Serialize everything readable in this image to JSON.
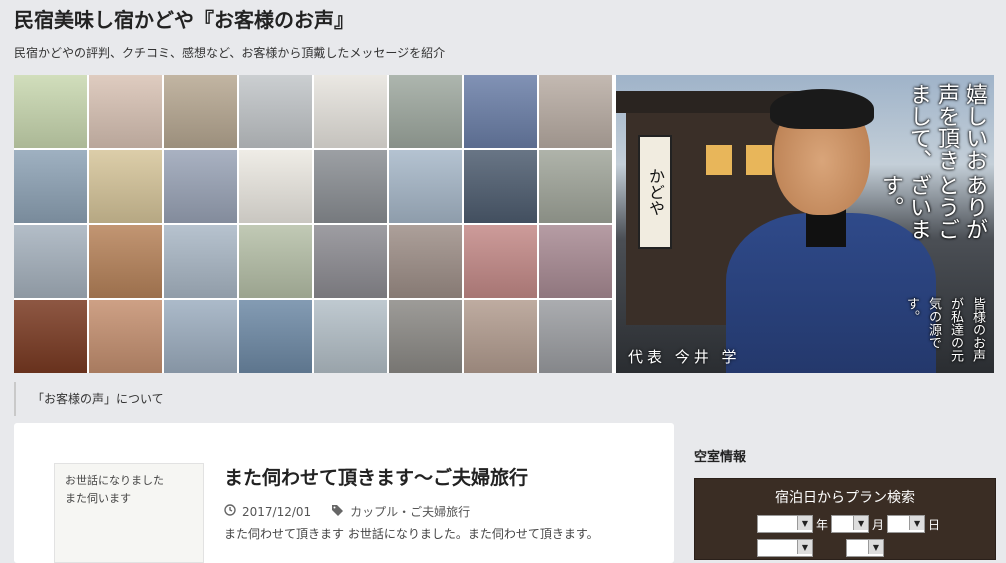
{
  "site": {
    "title": "民宿美味し宿かどや『お客様のお声』",
    "description": "民宿かどやの評判、クチコミ、感想など、お客様から頂戴したメッセージを紹介"
  },
  "banner": {
    "sign_text": "かどや",
    "heading_line1": "嬉しいお声を頂きまして、",
    "heading_line2": "ありがとうございます。",
    "sub_text": "皆様のお声が私達の元気の源です。",
    "representative": "代表 今井 学"
  },
  "about_link": "「お客様の声」について",
  "post": {
    "title": "また伺わせて頂きます～ご夫婦旅行",
    "date": "2017/12/01",
    "category": "カップル・ご夫婦旅行",
    "excerpt": "また伺わせて頂きます お世話になりました。また伺わせて頂きます。",
    "thumb_text_line1": "お世話になりました",
    "thumb_text_line2": "また伺います"
  },
  "sidebar": {
    "title": "空室情報",
    "plan_search_title": "宿泊日からプラン検索",
    "year_label": "年",
    "month_label": "月",
    "day_label": "日"
  },
  "colors": {
    "page_bg": "#e8e9ec",
    "widget_bg": "#3a2d24",
    "kimono_blue": "#2f4a8a"
  },
  "grid_photos": [
    "#c9d8b0",
    "#d9c3b5",
    "#b7a892",
    "#c2c6c9",
    "#e7e4de",
    "#9fa9a0",
    "#6b7fa8",
    "#b9ada4",
    "#8ea3b6",
    "#d6c59a",
    "#9aa4b7",
    "#ece9e2",
    "#8b8f94",
    "#a7b8c9",
    "#4e5d70",
    "#a1a69b",
    "#a6b2be",
    "#b7835a",
    "#aab8c6",
    "#b6c0a8",
    "#8d8c92",
    "#9e8f88",
    "#c48a88",
    "#a98b94",
    "#7a3a22",
    "#c59070",
    "#9daec0",
    "#6e8aa6",
    "#b4c0c8",
    "#8c8a86",
    "#b39d90",
    "#9c9ea2"
  ]
}
